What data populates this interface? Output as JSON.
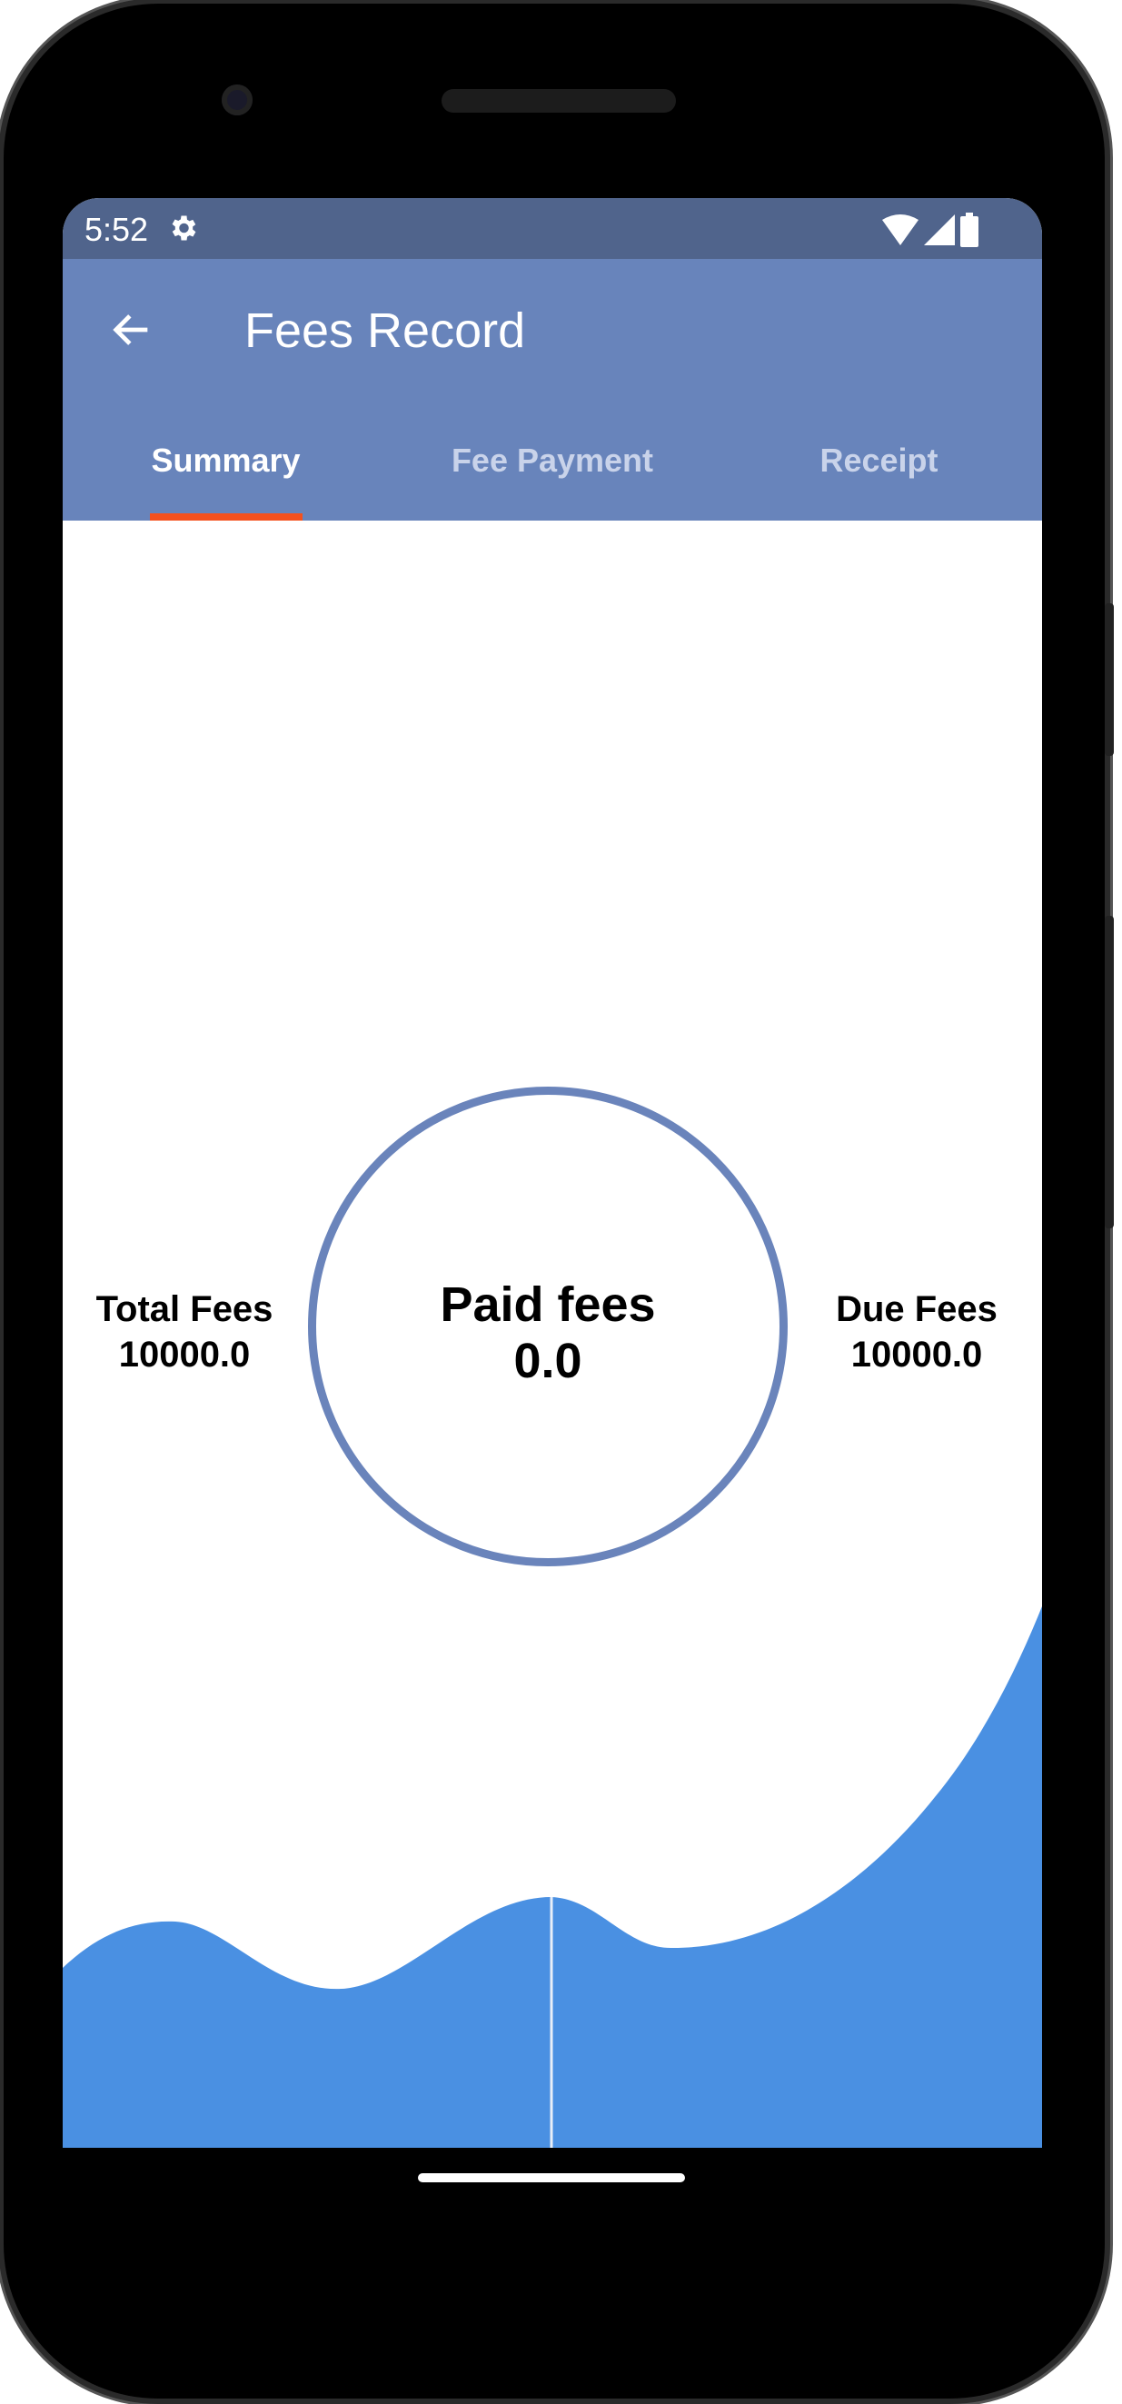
{
  "status_bar": {
    "time": "5:52",
    "icons": [
      "gear-icon",
      "wifi-icon",
      "signal-icon",
      "battery-icon"
    ]
  },
  "app_bar": {
    "title": "Fees Record",
    "back_icon": "arrow-left-icon"
  },
  "tabs": [
    {
      "label": "Summary",
      "active": true
    },
    {
      "label": "Fee Payment",
      "active": false
    },
    {
      "label": "Receipt",
      "active": false
    }
  ],
  "summary": {
    "total_label": "Total Fees",
    "total_value": "10000.0",
    "paid_label": "Paid fees",
    "paid_value": "0.0",
    "due_label": "Due Fees",
    "due_value": "10000.0"
  },
  "colors": {
    "status_bar": "#50648c",
    "app_bar": "#6884bb",
    "tab_indicator": "#f4511e",
    "circle": "#6a84bb",
    "wave": "#4a90e2"
  }
}
